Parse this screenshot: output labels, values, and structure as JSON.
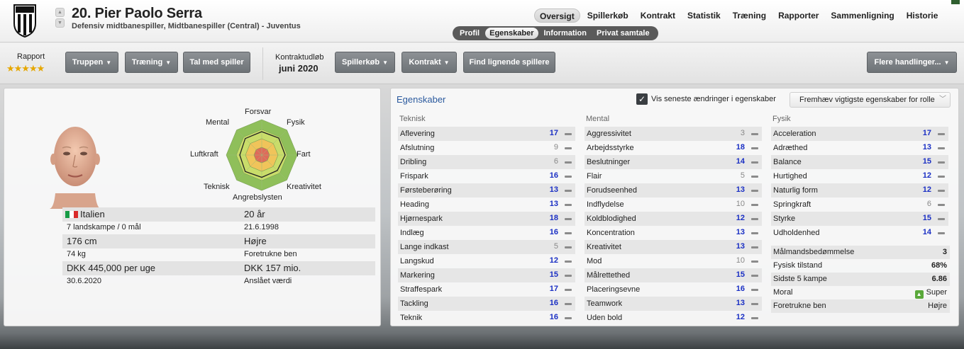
{
  "header": {
    "player_title": "20. Pier Paolo Serra",
    "player_role": "Defensiv midtbanespiller, Midtbanespiller (Central) - Juventus",
    "club_logo": "juventus-crest-icon",
    "main_tabs": [
      {
        "label": "Oversigt",
        "active": true
      },
      {
        "label": "Spillerkøb",
        "active": false
      },
      {
        "label": "Kontrakt",
        "active": false
      },
      {
        "label": "Statistik",
        "active": false
      },
      {
        "label": "Træning",
        "active": false
      },
      {
        "label": "Rapporter",
        "active": false
      },
      {
        "label": "Sammenligning",
        "active": false
      },
      {
        "label": "Historie",
        "active": false
      }
    ],
    "sub_tabs": [
      {
        "label": "Profil",
        "active": false
      },
      {
        "label": "Egenskaber",
        "active": true
      },
      {
        "label": "Information",
        "active": false
      },
      {
        "label": "Privat samtale",
        "active": false
      }
    ]
  },
  "toolbar": {
    "report_label": "Rapport",
    "report_stars": "★★★★★",
    "report_rating": 4.5,
    "buttons": {
      "squad": "Truppen",
      "training": "Træning",
      "talk": "Tal med spiller",
      "transfer": "Spillerkøb",
      "contract": "Kontrakt",
      "find_similar": "Find lignende spillere",
      "more_actions": "Flere handlinger..."
    },
    "contract_label": "Kontraktudløb",
    "contract_value": "juni 2020"
  },
  "radar": {
    "labels": {
      "defending": "Forsvar",
      "physical": "Fysik",
      "speed": "Fart",
      "creativity": "Kreativitet",
      "attacking": "Angrebslysten",
      "technical": "Teknisk",
      "aerial": "Luftkraft",
      "mental": "Mental"
    },
    "values": {
      "defending": 0.66,
      "physical": 0.68,
      "speed": 0.66,
      "creativity": 0.62,
      "attacking": 0.63,
      "technical": 0.66,
      "aerial": 0.62,
      "mental": 0.66
    },
    "colors": {
      "outer": "#8fbf5a",
      "ring2": "#c9dc6a",
      "ring3": "#f0c45a",
      "inner": "#e06a5a"
    }
  },
  "bio": {
    "nationality": "Italien",
    "caps": "7 landskampe / 0 mål",
    "age": "20 år",
    "dob": "21.6.1998",
    "height": "176 cm",
    "weight": "74 kg",
    "foot": "Højre",
    "foot_label": "Foretrukne ben",
    "wage": "DKK 445,000 per uge",
    "contract_end": "30.6.2020",
    "value": "DKK 157 mio.",
    "value_label": "Anslået værdi"
  },
  "attributes": {
    "title": "Egenskaber",
    "show_changes_label": "Vis seneste ændringer i egenskaber",
    "show_changes_checked": true,
    "highlight_select": "Fremhæv vigtigste egenskaber for rolle",
    "technical_head": "Teknisk",
    "mental_head": "Mental",
    "physical_head": "Fysik",
    "technical": [
      {
        "name": "Aflevering",
        "value": "17",
        "key": true
      },
      {
        "name": "Afslutning",
        "value": "9",
        "key": false
      },
      {
        "name": "Dribling",
        "value": "6",
        "key": false
      },
      {
        "name": "Frispark",
        "value": "16",
        "key": true
      },
      {
        "name": "Førsteberøring",
        "value": "13",
        "key": true
      },
      {
        "name": "Heading",
        "value": "13",
        "key": true
      },
      {
        "name": "Hjørnespark",
        "value": "18",
        "key": true
      },
      {
        "name": "Indlæg",
        "value": "16",
        "key": true
      },
      {
        "name": "Lange indkast",
        "value": "5",
        "key": false
      },
      {
        "name": "Langskud",
        "value": "12",
        "key": true
      },
      {
        "name": "Markering",
        "value": "15",
        "key": true
      },
      {
        "name": "Straffespark",
        "value": "17",
        "key": true
      },
      {
        "name": "Tackling",
        "value": "16",
        "key": true
      },
      {
        "name": "Teknik",
        "value": "16",
        "key": true
      }
    ],
    "mental": [
      {
        "name": "Aggressivitet",
        "value": "3",
        "key": false
      },
      {
        "name": "Arbejdsstyrke",
        "value": "18",
        "key": true
      },
      {
        "name": "Beslutninger",
        "value": "14",
        "key": true
      },
      {
        "name": "Flair",
        "value": "5",
        "key": false
      },
      {
        "name": "Forudseenhed",
        "value": "13",
        "key": true
      },
      {
        "name": "Indflydelse",
        "value": "10",
        "key": false
      },
      {
        "name": "Koldblodighed",
        "value": "12",
        "key": true
      },
      {
        "name": "Koncentration",
        "value": "13",
        "key": true
      },
      {
        "name": "Kreativitet",
        "value": "13",
        "key": true
      },
      {
        "name": "Mod",
        "value": "10",
        "key": false
      },
      {
        "name": "Målrettethed",
        "value": "15",
        "key": true
      },
      {
        "name": "Placeringsevne",
        "value": "16",
        "key": true
      },
      {
        "name": "Teamwork",
        "value": "13",
        "key": true
      },
      {
        "name": "Uden bold",
        "value": "12",
        "key": true
      }
    ],
    "physical": [
      {
        "name": "Acceleration",
        "value": "17",
        "key": true
      },
      {
        "name": "Adræthed",
        "value": "13",
        "key": true
      },
      {
        "name": "Balance",
        "value": "15",
        "key": true
      },
      {
        "name": "Hurtighed",
        "value": "12",
        "key": true
      },
      {
        "name": "Naturlig form",
        "value": "12",
        "key": true
      },
      {
        "name": "Springkraft",
        "value": "6",
        "key": false
      },
      {
        "name": "Styrke",
        "value": "15",
        "key": true
      },
      {
        "name": "Udholdenhed",
        "value": "14",
        "key": true
      }
    ],
    "extra": [
      {
        "name": "Målmandsbedømmelse",
        "value": "3",
        "bold": true
      },
      {
        "name": "Fysisk tilstand",
        "value": "68%",
        "bold": true
      },
      {
        "name": "Sidste 5 kampe",
        "value": "6.86",
        "bold": true
      },
      {
        "name": "Moral",
        "value": "Super",
        "bold": false,
        "icon": "arrow-up-icon"
      },
      {
        "name": "Foretrukne ben",
        "value": "Højre",
        "bold": false
      }
    ],
    "colors": {
      "key": "#1a2fc4",
      "normal": "#888888"
    }
  }
}
